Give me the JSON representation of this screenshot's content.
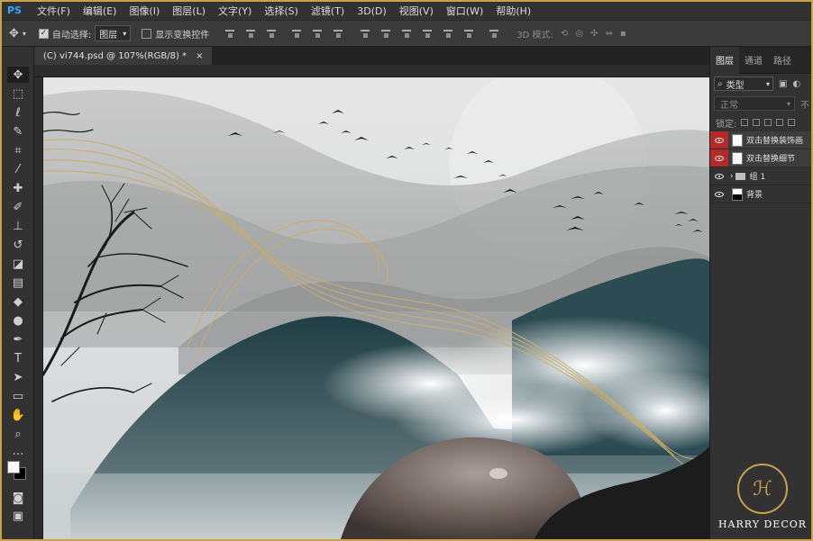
{
  "app": {
    "logo": "PS"
  },
  "menu": [
    "文件(F)",
    "编辑(E)",
    "图像(I)",
    "图层(L)",
    "文字(Y)",
    "选择(S)",
    "滤镜(T)",
    "3D(D)",
    "视图(V)",
    "窗口(W)",
    "帮助(H)"
  ],
  "options": {
    "auto_select_label": "自动选择:",
    "auto_select_value": "图层",
    "show_transform_label": "显示变换控件",
    "mode_3d_label": "3D 模式:"
  },
  "document": {
    "tab_title": "(C) vi744.psd @ 107%(RGB/8) *",
    "close": "×"
  },
  "layers_panel": {
    "tabs": [
      "图层",
      "通道",
      "路径"
    ],
    "filter_label": "类型",
    "blend_mode": "正常",
    "opacity_label": "不",
    "lock_label": "锁定:",
    "layers": [
      {
        "name": "双击替换装饰画",
        "visible": true,
        "smart": true
      },
      {
        "name": "双击替换细节",
        "visible": true,
        "smart": true
      },
      {
        "name": "组 1",
        "visible": true,
        "group": true
      },
      {
        "name": "背景",
        "visible": true,
        "background": true
      }
    ]
  },
  "watermark": {
    "logo_text": "HARRY DECOR"
  },
  "colors": {
    "accent": "#c9a24a",
    "eye_highlight": "#b22a2a"
  }
}
